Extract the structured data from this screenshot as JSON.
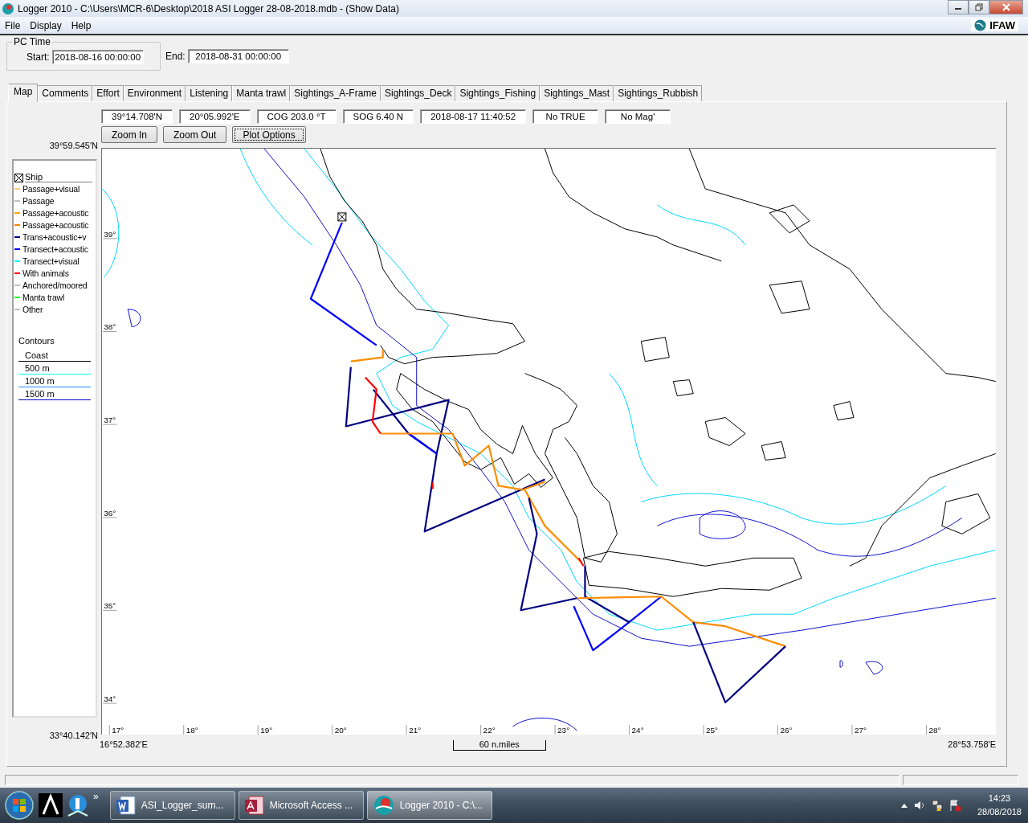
{
  "window": {
    "title": "Logger 2010 - C:\\Users\\MCR-6\\Desktop\\2018 ASI Logger 28-08-2018.mdb - (Show Data)"
  },
  "menu": [
    {
      "label": "File"
    },
    {
      "label": "Display"
    },
    {
      "label": "Help"
    }
  ],
  "brand": "IFAW",
  "pc_time": {
    "title": "PC Time",
    "start_label": "Start:",
    "start": "2018-08-16 00:00:00",
    "end_label": "End:",
    "end": "2018-08-31 00:00:00"
  },
  "tabs": [
    {
      "label": "Map",
      "selected": true
    },
    {
      "label": "Comments",
      "selected": false
    },
    {
      "label": "Effort",
      "selected": false
    },
    {
      "label": "Environment",
      "selected": false
    },
    {
      "label": "Listening",
      "selected": false
    },
    {
      "label": "Manta trawl",
      "selected": false
    },
    {
      "label": "Sightings_A-Frame",
      "selected": false
    },
    {
      "label": "Sightings_Deck",
      "selected": false
    },
    {
      "label": "Sightings_Fishing",
      "selected": false
    },
    {
      "label": "Sightings_Mast",
      "selected": false
    },
    {
      "label": "Sightings_Rubbish",
      "selected": false
    }
  ],
  "readouts": [
    "39°14.708'N",
    "20°05.992'E",
    "COG 203.0 °T",
    "SOG 6.40 N",
    "2018-08-17 11:40:52",
    "No TRUE",
    "No Mag'"
  ],
  "buttons": [
    {
      "label": "Zoom In",
      "focused": false
    },
    {
      "label": "Zoom Out",
      "focused": false
    },
    {
      "label": "Plot Options",
      "focused": true
    }
  ],
  "map": {
    "top_lat": "39°59.545'N",
    "bottom_lat": "33°40.142'N",
    "left_lon": "16°52.382'E",
    "right_lon": "28°53.758'E",
    "scale_label": "60 n.miles",
    "lat_ticks": [
      "39°",
      "38°",
      "37°",
      "36°",
      "35°",
      "34°"
    ],
    "lon_ticks": [
      "17°",
      "18°",
      "19°",
      "20°",
      "21°",
      "22°",
      "23°",
      "24°",
      "25°",
      "26°",
      "27°",
      "28°"
    ]
  },
  "legend": {
    "items": [
      {
        "kind": "ship",
        "label": "Ship"
      },
      {
        "kind": "track",
        "label": "Passage+visual",
        "color": "#ffc878"
      },
      {
        "kind": "track",
        "label": "Passage",
        "color": "#c0c0c0"
      },
      {
        "kind": "track",
        "label": "Passage+acoustic",
        "color": "#ffa500"
      },
      {
        "kind": "track",
        "label": "Passage+acoustic",
        "color": "#ff7f00"
      },
      {
        "kind": "track",
        "label": "Trans+acoustic+v",
        "color": "#000080"
      },
      {
        "kind": "track",
        "label": "Transect+acoustic",
        "color": "#0000ff"
      },
      {
        "kind": "track",
        "label": "Transect+visual",
        "color": "#00ffff"
      },
      {
        "kind": "track",
        "label": "With animals",
        "color": "#ff0000"
      },
      {
        "kind": "track",
        "label": "Anchored/moored",
        "color": "#c0c0c0"
      },
      {
        "kind": "track",
        "label": "Manta trawl",
        "color": "#00ff00"
      },
      {
        "kind": "track",
        "label": "Other",
        "color": "#c0c0c0"
      }
    ],
    "contours_title": "Contours",
    "contours": [
      {
        "label": "Coast",
        "color": "#000000"
      },
      {
        "label": "500 m",
        "color": "#00ffff"
      },
      {
        "label": "1000 m",
        "color": "#1e8cff"
      },
      {
        "label": "1500 m",
        "color": "#0000c8"
      }
    ]
  },
  "taskbar": {
    "tasks": [
      {
        "kind": "word",
        "label": "ASI_Logger_sum...",
        "selected": false
      },
      {
        "kind": "access",
        "label": "Microsoft Access ...",
        "selected": false
      },
      {
        "kind": "logger",
        "label": "Logger 2010 - C:\\...",
        "selected": true
      }
    ],
    "overflow": "»",
    "time": "14:23",
    "date": "28/08/2018"
  }
}
